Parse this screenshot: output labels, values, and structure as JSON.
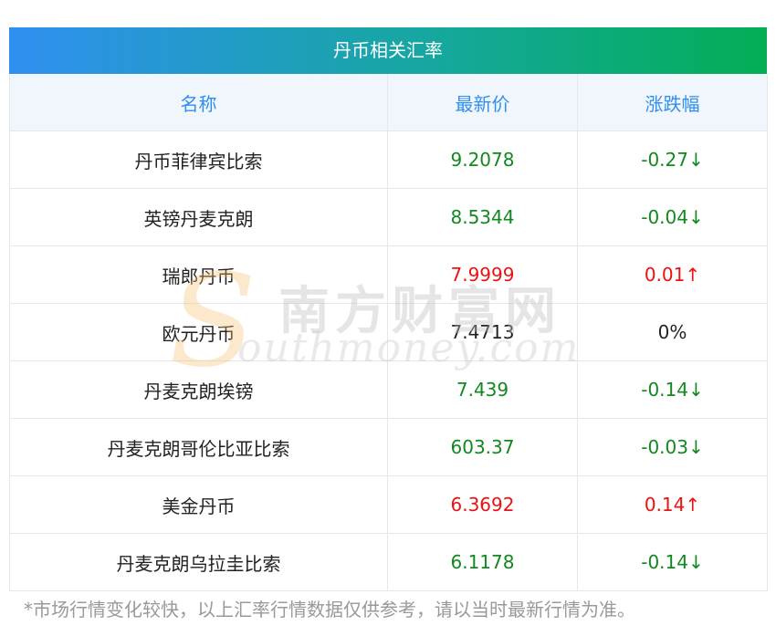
{
  "title": "丹币相关汇率",
  "headers": {
    "name": "名称",
    "price": "最新价",
    "change": "涨跌幅"
  },
  "rows": [
    {
      "name": "丹币菲律宾比索",
      "price": "9.2078",
      "change": "-0.27↓",
      "trend": "down"
    },
    {
      "name": "英镑丹麦克朗",
      "price": "8.5344",
      "change": "-0.04↓",
      "trend": "down"
    },
    {
      "name": "瑞郎丹币",
      "price": "7.9999",
      "change": "0.01↑",
      "trend": "up"
    },
    {
      "name": "欧元丹币",
      "price": "7.4713",
      "change": "0%",
      "trend": "flat"
    },
    {
      "name": "丹麦克朗埃镑",
      "price": "7.439",
      "change": "-0.14↓",
      "trend": "down"
    },
    {
      "name": "丹麦克朗哥伦比亚比索",
      "price": "603.37",
      "change": "-0.03↓",
      "trend": "down"
    },
    {
      "name": "美金丹币",
      "price": "6.3692",
      "change": "0.14↑",
      "trend": "up"
    },
    {
      "name": "丹麦克朗乌拉圭比索",
      "price": "6.1178",
      "change": "-0.14↓",
      "trend": "down"
    }
  ],
  "watermark": {
    "letter": "S",
    "chinese": "南方财富网",
    "english": "outhmoney.com"
  },
  "note": "*市场行情变化较快，以上汇率行情数据仅供参考，请以当时最新行情为准。",
  "colors": {
    "up": "#ee1111",
    "down": "#11891f",
    "header_text": "#2f8ff0",
    "gradient_start": "#2f8ff0",
    "gradient_end": "#03ae55"
  }
}
